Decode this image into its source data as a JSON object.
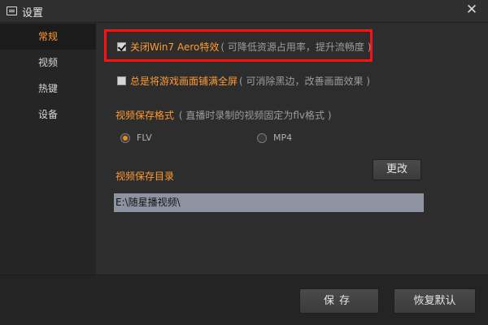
{
  "window": {
    "title": "设置",
    "close_glyph": "✕"
  },
  "sidebar": {
    "items": [
      {
        "label": "常规",
        "active": true
      },
      {
        "label": "视频",
        "active": false
      },
      {
        "label": "热键",
        "active": false
      },
      {
        "label": "设备",
        "active": false
      }
    ]
  },
  "general": {
    "option_aero": {
      "label": "关闭Win7 Aero特效",
      "note": "( 可降低资源占用率，提升流畅度 )",
      "checked": true
    },
    "option_fullscreen": {
      "label": "总是将游戏画面铺满全屏",
      "note": "( 可消除黑边，改善画面效果 )",
      "checked": false
    },
    "format": {
      "label": "视频保存格式",
      "note": "( 直播时录制的视频固定为flv格式 )",
      "options": [
        {
          "label": "FLV",
          "selected": true
        },
        {
          "label": "MP4",
          "selected": false
        }
      ]
    },
    "dir": {
      "label": "视频保存目录",
      "change_label": "更改",
      "path": "E:\\随星播视频\\"
    }
  },
  "footer": {
    "save_label": "保存",
    "reset_label": "恢复默认"
  },
  "colors": {
    "accent": "#ff9a33",
    "highlight_box": "#ff1010"
  }
}
